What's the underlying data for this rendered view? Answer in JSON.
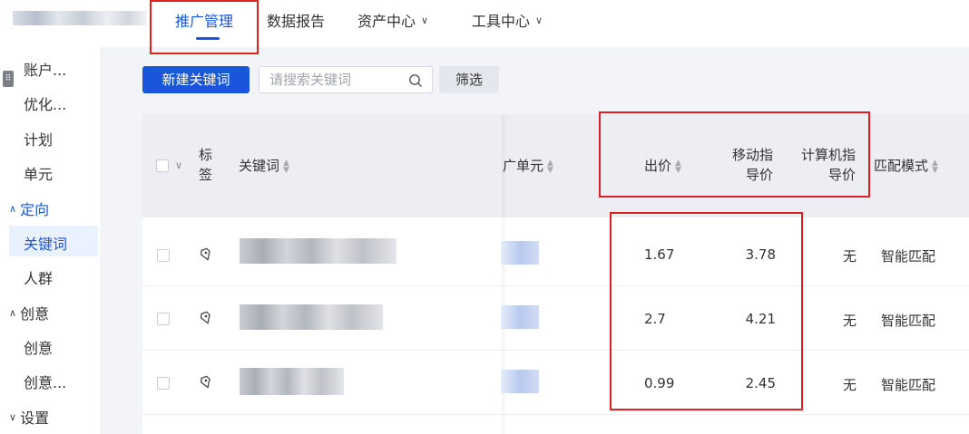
{
  "topnav": {
    "tabs": [
      {
        "label": "推广管理",
        "active": true
      },
      {
        "label": "数据报告"
      },
      {
        "label": "资产中心"
      },
      {
        "label": "工具中心"
      }
    ]
  },
  "sidebar": {
    "items": [
      {
        "label": "账户..."
      },
      {
        "label": "优化..."
      },
      {
        "label": "计划"
      },
      {
        "label": "单元"
      },
      {
        "label": "定向",
        "group": true,
        "expanded": true
      },
      {
        "label": "关键词",
        "selected": true
      },
      {
        "label": "人群"
      },
      {
        "label": "创意",
        "group": true
      },
      {
        "label": "创意"
      },
      {
        "label": "创意..."
      },
      {
        "label": "设置",
        "group": true
      }
    ]
  },
  "toolbar": {
    "new_keyword": "新建关键词",
    "search_placeholder": "请搜索关键词",
    "filter": "筛选"
  },
  "table": {
    "headers": {
      "tag_line1": "标",
      "tag_line2": "签",
      "keyword": "关键词",
      "unit": "广单元",
      "bid": "出价",
      "mobile_line1": "移动指",
      "mobile_line2": "导价",
      "pc_line1": "计算机指",
      "pc_line2": "导价",
      "match": "匹配模式"
    },
    "rows": [
      {
        "bid": "1.67",
        "mobile": "3.78",
        "pc": "无",
        "match": "智能匹配"
      },
      {
        "bid": "2.7",
        "mobile": "4.21",
        "pc": "无",
        "match": "智能匹配"
      },
      {
        "bid": "0.99",
        "mobile": "2.45",
        "pc": "无",
        "match": "智能匹配"
      }
    ]
  },
  "colors": {
    "accent": "#1a56db",
    "highlight_box": "#e02020"
  }
}
